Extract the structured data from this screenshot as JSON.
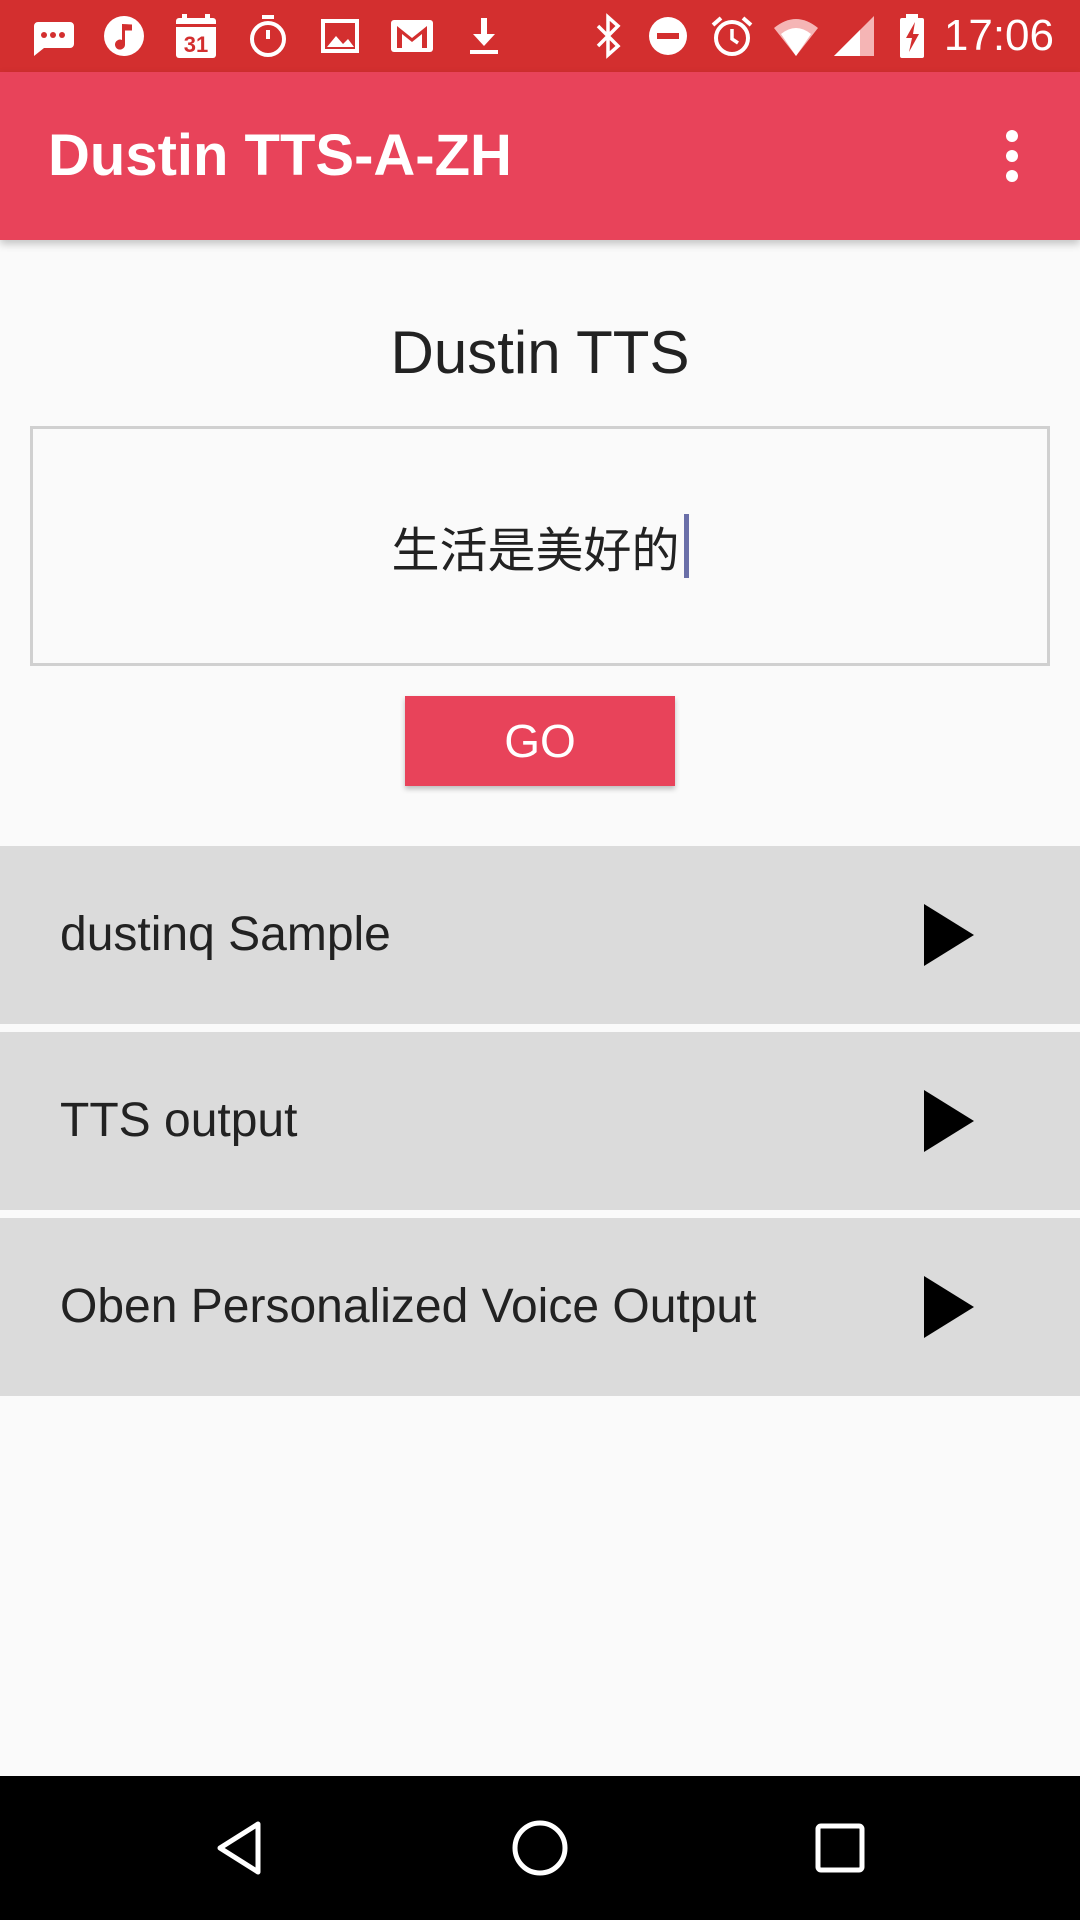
{
  "status_bar": {
    "time": "17:06",
    "left_icons": [
      "messages-icon",
      "music-icon",
      "calendar-icon",
      "stopwatch-icon",
      "image-icon",
      "gmail-icon",
      "download-icon"
    ],
    "right_icons": [
      "bluetooth-icon",
      "do-not-disturb-icon",
      "alarm-icon",
      "wifi-icon",
      "signal-icon",
      "battery-charging-icon"
    ],
    "calendar_day": "31"
  },
  "app_bar": {
    "title": "Dustin TTS-A-ZH",
    "overflow_icon": "more-vert-icon"
  },
  "main": {
    "heading": "Dustin TTS",
    "input_value": "生活是美好的",
    "go_label": "GO"
  },
  "list": {
    "items": [
      {
        "label": "dustinq Sample",
        "icon": "play-icon"
      },
      {
        "label": "TTS output",
        "icon": "play-icon"
      },
      {
        "label": "Oben Personalized Voice Output",
        "icon": "play-icon"
      }
    ]
  },
  "nav_bar": {
    "buttons": [
      "back-icon",
      "home-icon",
      "recents-icon"
    ]
  },
  "colors": {
    "status_bar": "#d32f2f",
    "accent": "#e8435a",
    "row_bg": "#dbdbdb",
    "caret": "#6a6fa8"
  }
}
